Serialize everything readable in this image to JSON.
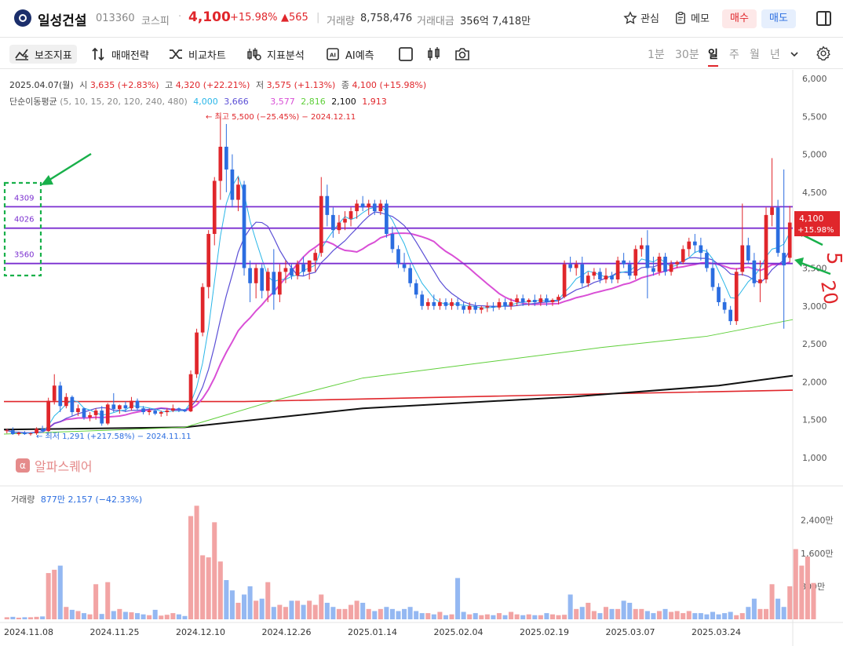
{
  "header": {
    "name": "일성건설",
    "code": "013360",
    "market": "코스피",
    "price": "4,100",
    "pct": "+15.98%",
    "change": "▲565",
    "volume_label": "거래량",
    "volume": "8,758,476",
    "amount_label": "거래대금",
    "amount": "356억 7,418만",
    "watch_label": "관심",
    "memo_label": "메모",
    "buy_label": "매수",
    "sell_label": "매도"
  },
  "toolbar": {
    "indicators": "보조지표",
    "strategy": "매매전략",
    "compare": "비교차트",
    "analysis": "지표분석",
    "ai": "AI예측",
    "periods": [
      "1분",
      "30분",
      "일",
      "주",
      "월",
      "년"
    ],
    "selected_period": "일"
  },
  "ohlc": {
    "date": "2025.04.07(월)",
    "open_label": "시",
    "open": "3,635",
    "open_pct": "(+2.83%)",
    "high_label": "고",
    "high": "4,320",
    "high_pct": "(+22.21%)",
    "low_label": "저",
    "low": "3,575",
    "low_pct": "(+1.13%)",
    "close_label": "종",
    "close": "4,100",
    "close_pct": "(+15.98%)"
  },
  "ma": {
    "label": "단순이동평균",
    "periods": "(5, 10, 15, 20, 120, 240, 480)",
    "values": [
      {
        "v": "4,000",
        "color": "#29b6e8"
      },
      {
        "v": "3,666",
        "color": "#5b4fd6"
      },
      {
        "v": "3,577",
        "color": "#d94fd6"
      },
      {
        "v": "2,816",
        "color": "#5fcf3a"
      },
      {
        "v": "2,100",
        "color": "#111111"
      },
      {
        "v": "1,913",
        "color": "#e0262b"
      }
    ]
  },
  "annotations": {
    "max": "최고 5,500 (−25.45%) − 2024.12.11",
    "min": "최저 1,291 (+217.58%) − 2024.11.11",
    "level_high": "4309",
    "level_mid": "4026",
    "level_low": "3560",
    "handwritten_5": "5",
    "handwritten_20": "20"
  },
  "price_axis": [
    "6,000",
    "5,500",
    "5,000",
    "4,500",
    "4,000",
    "3,500",
    "3,000",
    "2,500",
    "2,000",
    "1,500",
    "1,000"
  ],
  "last_price_tag": {
    "price": "4,100",
    "pct": "+15.98%"
  },
  "watermark": "알파스퀘어",
  "volume_panel": {
    "label": "거래량",
    "value": "877만 2,157 (−42.33%)",
    "axis": [
      "2,400만",
      "1,600만",
      "800만"
    ]
  },
  "date_axis": [
    "2024.11.08",
    "2024.11.25",
    "2024.12.10",
    "2024.12.26",
    "2025.01.14",
    "2025.02.04",
    "2025.02.19",
    "2025.03.07",
    "2025.03.24"
  ],
  "chart_data": {
    "type": "candlestick",
    "ylim": [
      800,
      6100
    ],
    "colors": {
      "up": "#e0262b",
      "down": "#2b6de0"
    },
    "candles": [
      [
        1350,
        1380,
        1320,
        1360
      ],
      [
        1360,
        1400,
        1300,
        1310
      ],
      [
        1310,
        1340,
        1291,
        1330
      ],
      [
        1330,
        1350,
        1300,
        1310
      ],
      [
        1310,
        1330,
        1290,
        1320
      ],
      [
        1320,
        1400,
        1300,
        1380
      ],
      [
        1380,
        1420,
        1340,
        1350
      ],
      [
        1350,
        1790,
        1340,
        1750
      ],
      [
        1750,
        2100,
        1700,
        1950
      ],
      [
        1950,
        2000,
        1600,
        1680
      ],
      [
        1680,
        1850,
        1650,
        1800
      ],
      [
        1800,
        1820,
        1550,
        1600
      ],
      [
        1600,
        1700,
        1550,
        1650
      ],
      [
        1650,
        1660,
        1500,
        1530
      ],
      [
        1530,
        1600,
        1480,
        1560
      ],
      [
        1560,
        1650,
        1500,
        1620
      ],
      [
        1620,
        1680,
        1420,
        1450
      ],
      [
        1450,
        1720,
        1430,
        1700
      ],
      [
        1700,
        1850,
        1600,
        1640
      ],
      [
        1640,
        1700,
        1580,
        1690
      ],
      [
        1690,
        1740,
        1600,
        1650
      ],
      [
        1650,
        1800,
        1620,
        1750
      ],
      [
        1750,
        1780,
        1620,
        1650
      ],
      [
        1650,
        1680,
        1570,
        1600
      ],
      [
        1600,
        1650,
        1560,
        1620
      ],
      [
        1620,
        1640,
        1560,
        1580
      ],
      [
        1580,
        1620,
        1540,
        1600
      ],
      [
        1600,
        1650,
        1550,
        1620
      ],
      [
        1620,
        1700,
        1600,
        1650
      ],
      [
        1650,
        1660,
        1600,
        1630
      ],
      [
        1630,
        1640,
        1600,
        1610
      ],
      [
        1610,
        2150,
        1600,
        2100
      ],
      [
        2100,
        2700,
        2050,
        2650
      ],
      [
        2650,
        3300,
        2600,
        3250
      ],
      [
        3250,
        4000,
        3100,
        3950
      ],
      [
        3950,
        4700,
        3800,
        4650
      ],
      [
        4650,
        5500,
        4400,
        5100
      ],
      [
        5100,
        5400,
        4500,
        4800
      ],
      [
        4800,
        5000,
        4300,
        4400
      ],
      [
        4400,
        4700,
        4250,
        4600
      ],
      [
        4600,
        4650,
        3400,
        3500
      ],
      [
        3500,
        3600,
        3050,
        3300
      ],
      [
        3300,
        3550,
        3100,
        3500
      ],
      [
        3500,
        3550,
        3100,
        3200
      ],
      [
        3200,
        3500,
        3050,
        3450
      ],
      [
        3450,
        3750,
        2950,
        3150
      ],
      [
        3150,
        3550,
        3050,
        3450
      ],
      [
        3450,
        3600,
        3300,
        3500
      ],
      [
        3500,
        3550,
        3350,
        3400
      ],
      [
        3400,
        3600,
        3350,
        3550
      ],
      [
        3550,
        3650,
        3400,
        3450
      ],
      [
        3450,
        3600,
        3350,
        3600
      ],
      [
        3600,
        3750,
        3450,
        3700
      ],
      [
        3700,
        4700,
        3650,
        4450
      ],
      [
        4450,
        4600,
        4050,
        4200
      ],
      [
        4200,
        4300,
        3900,
        4000
      ],
      [
        4000,
        4200,
        3950,
        4100
      ],
      [
        4100,
        4250,
        4000,
        4150
      ],
      [
        4150,
        4300,
        4050,
        4250
      ],
      [
        4250,
        4400,
        4150,
        4350
      ],
      [
        4350,
        4450,
        4250,
        4300
      ],
      [
        4300,
        4400,
        4200,
        4350
      ],
      [
        4350,
        4400,
        4200,
        4250
      ],
      [
        4250,
        4400,
        4200,
        4350
      ],
      [
        4350,
        4400,
        3900,
        3950
      ],
      [
        3950,
        4050,
        3700,
        3750
      ],
      [
        3750,
        3800,
        3500,
        3550
      ],
      [
        3550,
        3700,
        3450,
        3500
      ],
      [
        3500,
        3550,
        3250,
        3300
      ],
      [
        3300,
        3350,
        3100,
        3150
      ],
      [
        3150,
        3200,
        2950,
        3000
      ],
      [
        3000,
        3100,
        2950,
        3050
      ],
      [
        3050,
        3150,
        2950,
        3000
      ],
      [
        3000,
        3100,
        2950,
        3050
      ],
      [
        3050,
        3100,
        2950,
        3000
      ],
      [
        3000,
        3100,
        2950,
        3050
      ],
      [
        3050,
        3100,
        2950,
        3000
      ],
      [
        3000,
        3050,
        2900,
        2950
      ],
      [
        2950,
        3050,
        2900,
        3000
      ],
      [
        3000,
        3050,
        2900,
        2950
      ],
      [
        2950,
        3000,
        2900,
        2980
      ],
      [
        2980,
        3050,
        2920,
        3000
      ],
      [
        3000,
        3050,
        2930,
        2980
      ],
      [
        2980,
        3100,
        2950,
        3050
      ],
      [
        3050,
        3100,
        2950,
        3000
      ],
      [
        3000,
        3100,
        2950,
        3050
      ],
      [
        3050,
        3150,
        3000,
        3100
      ],
      [
        3100,
        3150,
        3000,
        3050
      ],
      [
        3050,
        3100,
        3000,
        3080
      ],
      [
        3080,
        3150,
        3000,
        3050
      ],
      [
        3050,
        3150,
        3000,
        3100
      ],
      [
        3100,
        3150,
        3000,
        3050
      ],
      [
        3050,
        3100,
        3000,
        3080
      ],
      [
        3080,
        3150,
        3020,
        3120
      ],
      [
        3120,
        3600,
        3100,
        3550
      ],
      [
        3550,
        3650,
        3450,
        3500
      ],
      [
        3500,
        3600,
        3400,
        3550
      ],
      [
        3550,
        3650,
        3250,
        3300
      ],
      [
        3300,
        3450,
        3250,
        3400
      ],
      [
        3400,
        3500,
        3350,
        3450
      ],
      [
        3450,
        3500,
        3300,
        3350
      ],
      [
        3350,
        3500,
        3300,
        3400
      ],
      [
        3400,
        3450,
        3300,
        3350
      ],
      [
        3350,
        3650,
        3300,
        3600
      ],
      [
        3600,
        3700,
        3500,
        3550
      ],
      [
        3550,
        3600,
        3350,
        3400
      ],
      [
        3400,
        3800,
        3350,
        3750
      ],
      [
        3750,
        3900,
        3650,
        3800
      ],
      [
        3800,
        4000,
        3100,
        3500
      ],
      [
        3500,
        3650,
        3400,
        3450
      ],
      [
        3450,
        3700,
        3400,
        3650
      ],
      [
        3650,
        3700,
        3400,
        3450
      ],
      [
        3450,
        3600,
        3400,
        3550
      ],
      [
        3550,
        3600,
        3500,
        3580
      ],
      [
        3580,
        3800,
        3550,
        3750
      ],
      [
        3750,
        3900,
        3650,
        3850
      ],
      [
        3850,
        3950,
        3700,
        3800
      ],
      [
        3800,
        3900,
        3600,
        3700
      ],
      [
        3700,
        3750,
        3450,
        3500
      ],
      [
        3500,
        3600,
        3200,
        3250
      ],
      [
        3250,
        3300,
        3000,
        3050
      ],
      [
        3050,
        3100,
        2900,
        2950
      ],
      [
        2950,
        3000,
        2750,
        2800
      ],
      [
        2800,
        3500,
        2750,
        3450
      ],
      [
        3450,
        4350,
        3400,
        3800
      ],
      [
        3800,
        3900,
        3550,
        3600
      ],
      [
        3600,
        3700,
        3250,
        3300
      ],
      [
        3300,
        3600,
        3050,
        3350
      ],
      [
        3350,
        4300,
        3300,
        4200
      ],
      [
        4200,
        4950,
        4050,
        4300
      ],
      [
        4300,
        4400,
        3650,
        3700
      ],
      [
        3700,
        4800,
        2700,
        3535
      ],
      [
        3635,
        4320,
        3575,
        4100
      ]
    ],
    "volume_m": [
      0.5,
      0.6,
      0.4,
      0.5,
      0.5,
      0.6,
      0.7,
      11.2,
      12.0,
      13.0,
      3.0,
      2.3,
      2.0,
      1.5,
      1.2,
      8.5,
      1.3,
      9.0,
      2.0,
      2.5,
      1.8,
      1.7,
      1.5,
      1.2,
      1.0,
      2.3,
      0.9,
      1.1,
      1.5,
      1.2,
      0.8,
      25.0,
      27.5,
      15.5,
      15.0,
      23.5,
      14.0,
      9.5,
      7.0,
      4.0,
      6.0,
      8.0,
      4.5,
      5.0,
      9.0,
      3.0,
      3.5,
      3.0,
      4.5,
      4.5,
      3.5,
      4.5,
      3.5,
      6.0,
      4.0,
      3.0,
      2.5,
      2.5,
      3.5,
      4.5,
      4.0,
      2.5,
      2.0,
      2.5,
      3.0,
      2.5,
      2.0,
      2.5,
      3.0,
      2.0,
      1.5,
      1.5,
      1.2,
      1.8,
      1.0,
      1.2,
      10.0,
      1.8,
      1.2,
      1.5,
      1.0,
      1.2,
      1.0,
      1.5,
      1.0,
      1.8,
      1.2,
      1.0,
      1.2,
      1.0,
      1.0,
      1.5,
      1.2,
      1.0,
      1.1,
      6.0,
      2.5,
      3.0,
      4.0,
      2.0,
      1.5,
      3.0,
      2.5,
      2.5,
      4.5,
      4.0,
      2.5,
      2.5,
      2.0,
      1.5,
      2.0,
      2.5,
      1.8,
      2.0,
      1.5,
      2.0,
      1.5,
      1.5,
      1.2,
      1.8,
      1.2,
      1.5,
      1.8,
      1.0,
      1.5,
      3.0,
      5.0,
      2.5,
      2.5,
      8.5,
      5.0,
      3.0,
      8.0,
      17.0,
      13.0,
      15.2,
      8.8
    ],
    "ma_levels": {
      "ma120": [
        1310,
        2100
      ],
      "ma240": [
        1740,
        1913
      ]
    }
  }
}
